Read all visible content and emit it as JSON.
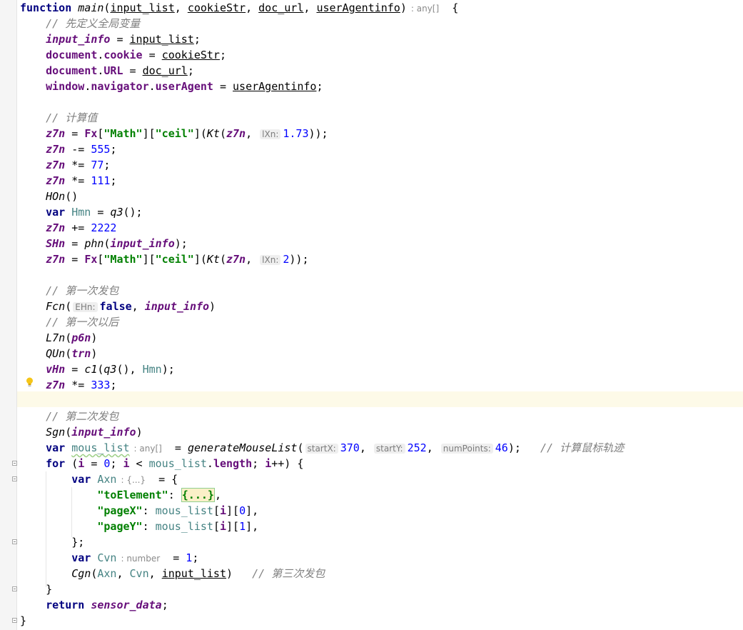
{
  "editor": {
    "comments": {
      "define_globals": "// 先定义全局变量",
      "compute_values": "// 计算值",
      "first_send": "// 第一次发包",
      "after_first": "// 第一次以后",
      "second_send": "// 第二次发包",
      "compute_mouse": "// 计算鼠标轨迹",
      "third_send": "// 第三次发包"
    },
    "hints": {
      "return_type": ": any[]",
      "lXn": "lXn:",
      "EHn": "EHn:",
      "mous_type": ": any[]",
      "startX": "startX:",
      "startY": "startY:",
      "numPoints": "numPoints:",
      "axn_type": ": {...}",
      "cvn_type": ": number"
    },
    "numbers": {
      "ceil_arg": "1.73",
      "sub": "555",
      "mul1": "77",
      "mul2": "111",
      "add": "2222",
      "ceil_arg2": "2",
      "mul3": "333",
      "start_x": "370",
      "start_y": "252",
      "num_points": "46",
      "zero": "0",
      "one": "1",
      "cvn": "1"
    },
    "strings": {
      "math": "\"Math\"",
      "ceil": "\"ceil\"",
      "to_element": "\"toElement\"",
      "page_x": "\"pageX\"",
      "page_y": "\"pageY\""
    },
    "folded_placeholder": "{...}"
  }
}
